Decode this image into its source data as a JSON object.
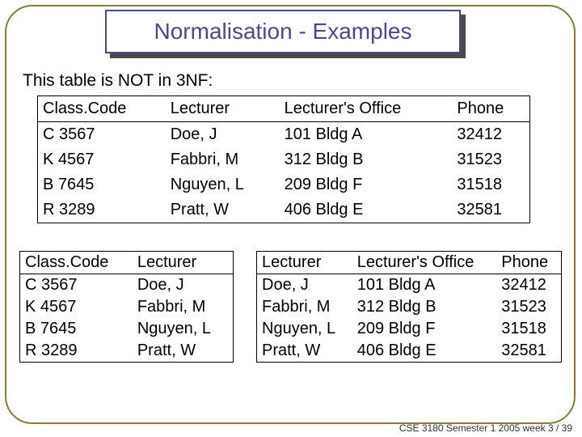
{
  "title": "Normalisation - Examples",
  "intro": "This table is NOT in 3NF:",
  "main_table": {
    "headers": [
      "Class.Code",
      "Lecturer",
      "Lecturer's Office",
      "Phone"
    ],
    "rows": [
      [
        "C 3567",
        "Doe, J",
        "101 Bldg A",
        "32412"
      ],
      [
        "K 4567",
        "Fabbri, M",
        "312 Bldg B",
        "31523"
      ],
      [
        "B 7645",
        "Nguyen, L",
        "209 Bldg F",
        "31518"
      ],
      [
        "R 3289",
        "Pratt, W",
        "406 Bldg E",
        "32581"
      ]
    ]
  },
  "left_table": {
    "headers": [
      "Class.Code",
      "Lecturer"
    ],
    "rows": [
      [
        "C 3567",
        "Doe, J"
      ],
      [
        "K 4567",
        "Fabbri, M"
      ],
      [
        "B 7645",
        "Nguyen, L"
      ],
      [
        "R 3289",
        "Pratt, W"
      ]
    ]
  },
  "right_table": {
    "headers": [
      "Lecturer",
      "Lecturer's Office",
      "Phone"
    ],
    "rows": [
      [
        "Doe, J",
        "101 Bldg A",
        "32412"
      ],
      [
        "Fabbri, M",
        "312 Bldg B",
        "31523"
      ],
      [
        "Nguyen, L",
        "209 Bldg F",
        "31518"
      ],
      [
        "Pratt, W",
        "406 Bldg E",
        "32581"
      ]
    ]
  },
  "footer": "CSE 3180 Semester 1 2005  week 3 / 39"
}
